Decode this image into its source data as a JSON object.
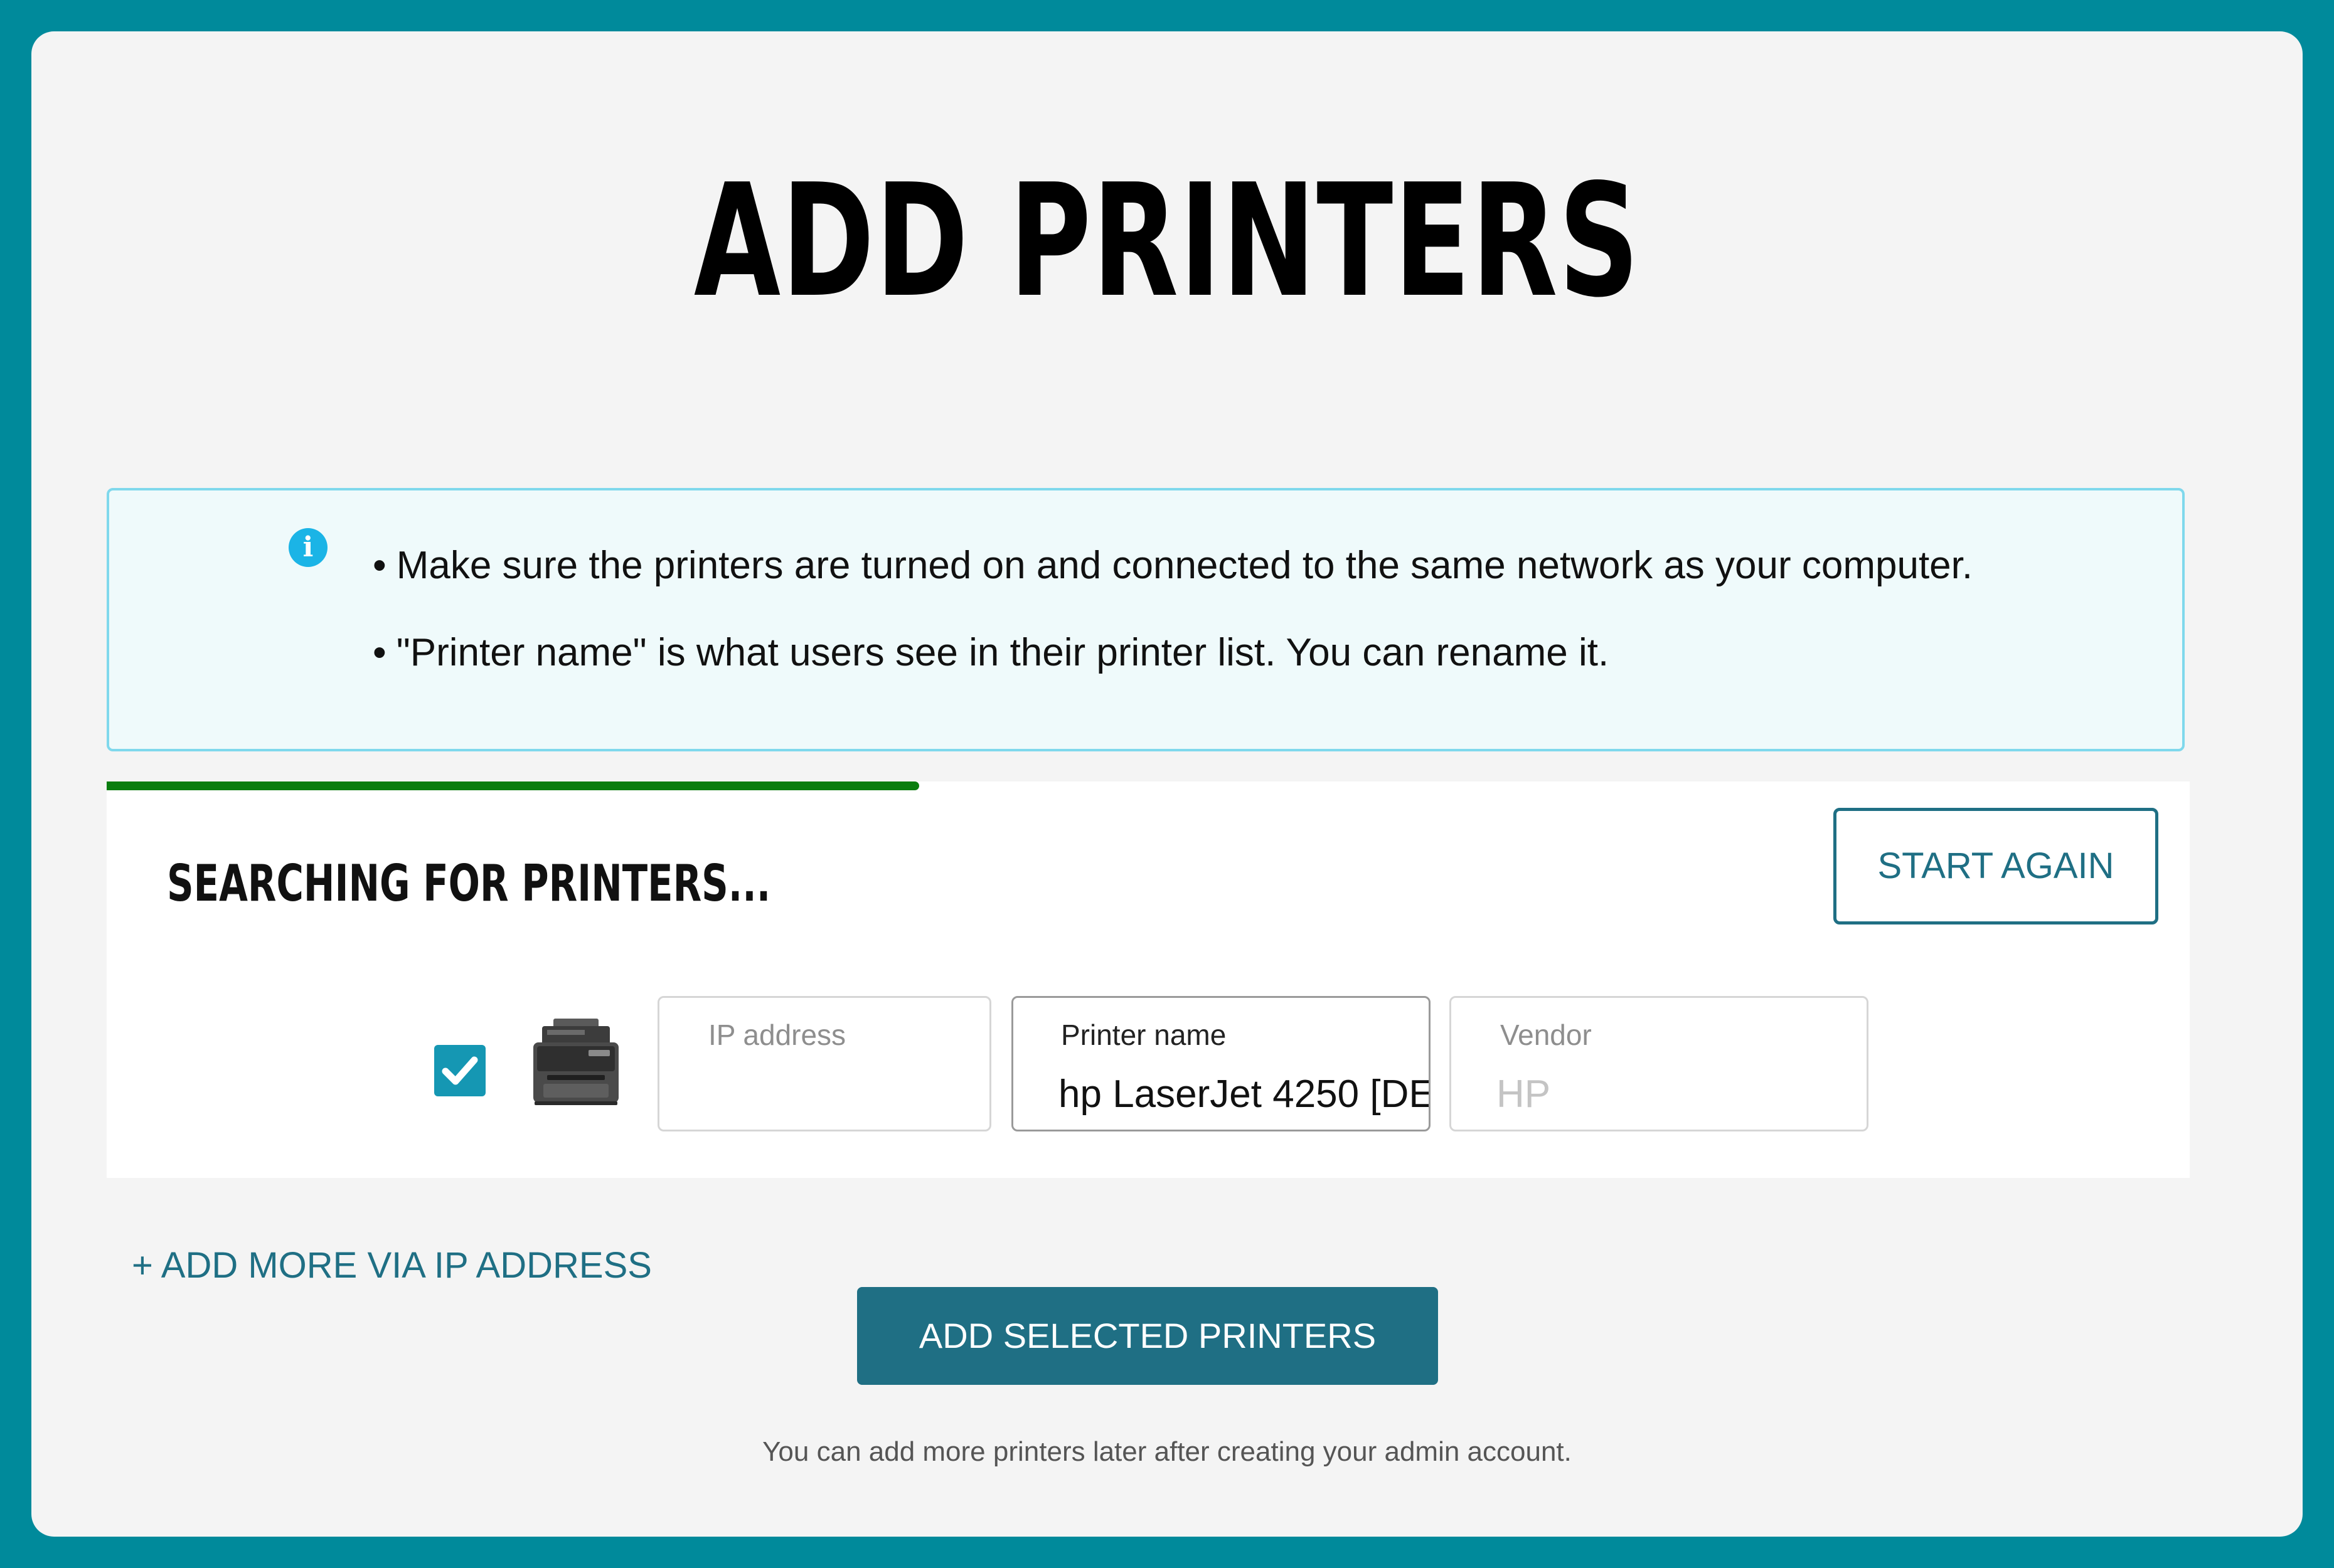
{
  "page": {
    "title": "ADD PRINTERS"
  },
  "info": {
    "icon": "info-icon",
    "bullet": "•",
    "lines": [
      "Make sure the printers are turned on and connected to the same network as your computer.",
      "\"Printer name\" is what users see in their printer list. You can rename it."
    ]
  },
  "search": {
    "title": "SEARCHING FOR PRINTERS...",
    "progress": 0.39,
    "progress_color": "#0a7d0f",
    "start_again_label": "START AGAIN"
  },
  "printer_row": {
    "checked": true,
    "ip_label": "IP address",
    "ip_value": "",
    "name_label": "Printer name",
    "name_value": "hp LaserJet 4250 [DE",
    "vendor_label": "Vendor",
    "vendor_value": "HP"
  },
  "actions": {
    "add_more_label": "+ ADD MORE VIA IP ADDRESS",
    "add_selected_label": "ADD SELECTED PRINTERS",
    "footnote": "You can add more printers later after creating your admin account."
  },
  "colors": {
    "background": "#008a9b",
    "accent": "#1f6f84",
    "info_border": "#7fd8ec",
    "info_bg": "#effafb"
  }
}
